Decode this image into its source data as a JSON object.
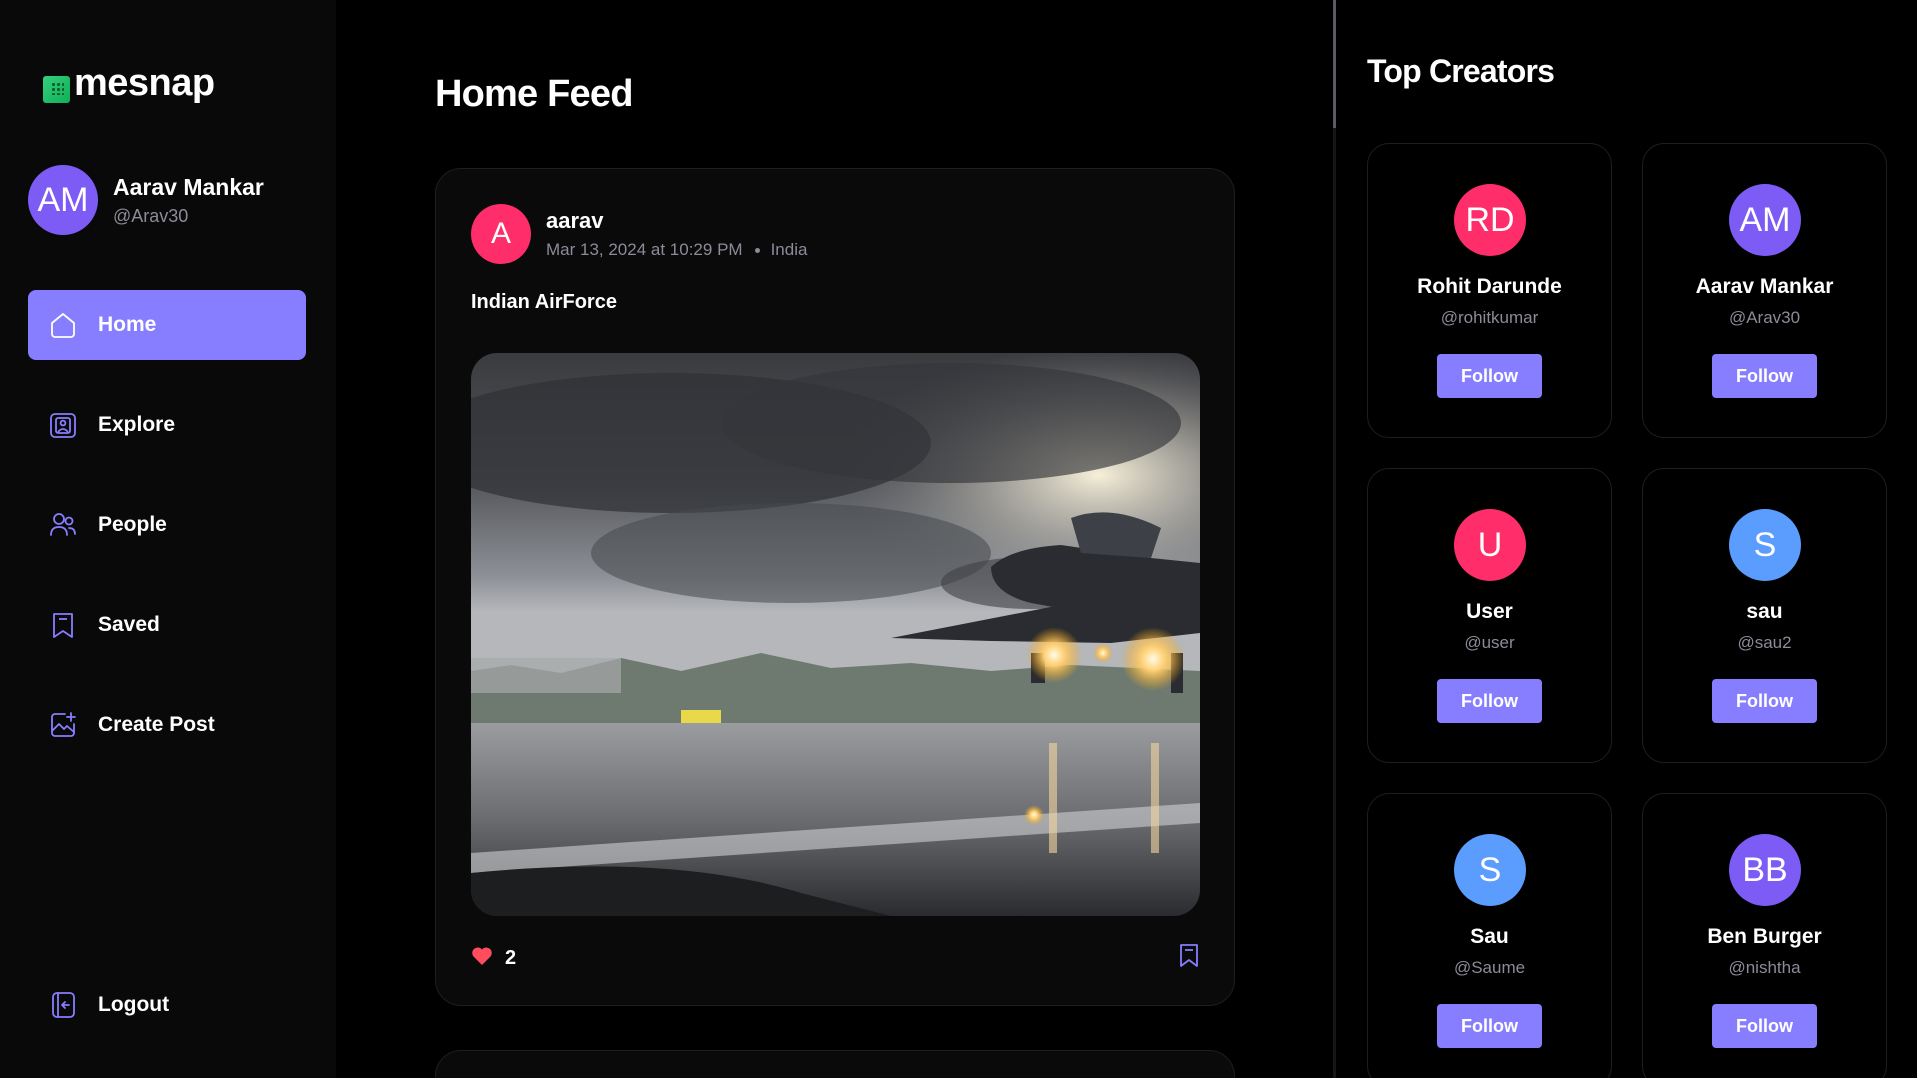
{
  "app": {
    "brand": "mesnap",
    "accent_color": "#877eff"
  },
  "sidebar": {
    "user": {
      "initials": "AM",
      "name": "Aarav Mankar",
      "handle": "@Arav30",
      "avatar_color": "#7c5cf5"
    },
    "items": [
      {
        "label": "Home",
        "icon": "home-icon",
        "active": true
      },
      {
        "label": "Explore",
        "icon": "explore-icon",
        "active": false
      },
      {
        "label": "People",
        "icon": "people-icon",
        "active": false
      },
      {
        "label": "Saved",
        "icon": "bookmark-icon",
        "active": false
      },
      {
        "label": "Create Post",
        "icon": "create-post-icon",
        "active": false
      }
    ],
    "logout_label": "Logout"
  },
  "feed": {
    "title": "Home Feed",
    "post": {
      "author_initial": "A",
      "author": "aarav",
      "avatar_color": "#ff2d6a",
      "date": "Mar 13, 2024 at 10:29 PM",
      "location": "India",
      "caption": "Indian AirForce",
      "image_alt": "fighter-jet-takeoff",
      "likes": "2",
      "like_icon": "heart-icon",
      "save_icon": "bookmark-icon"
    }
  },
  "top_creators": {
    "title": "Top Creators",
    "follow_label": "Follow",
    "creators": [
      {
        "initials": "RD",
        "name": "Rohit Darunde",
        "handle": "@rohitkumar",
        "color": "#ff2d6a"
      },
      {
        "initials": "AM",
        "name": "Aarav Mankar",
        "handle": "@Arav30",
        "color": "#7c5cf5"
      },
      {
        "initials": "U",
        "name": "User",
        "handle": "@user",
        "color": "#ff2d6a"
      },
      {
        "initials": "S",
        "name": "sau",
        "handle": "@sau2",
        "color": "#5b9cff"
      },
      {
        "initials": "S",
        "name": "Sau",
        "handle": "@Saume",
        "color": "#5b9cff"
      },
      {
        "initials": "BB",
        "name": "Ben Burger",
        "handle": "@nishtha",
        "color": "#7c5cf5"
      }
    ]
  }
}
